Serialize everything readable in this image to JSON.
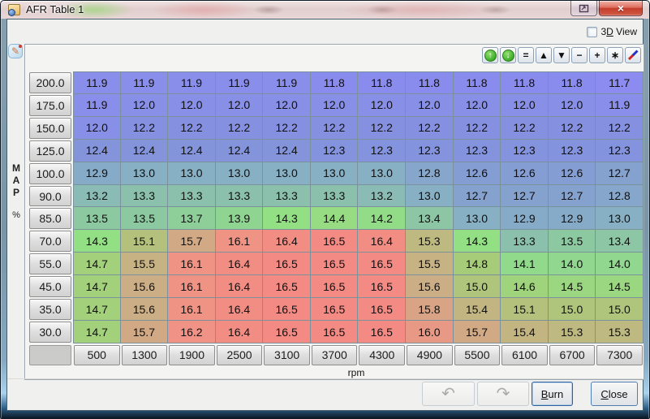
{
  "window": {
    "title": "AFR Table 1",
    "controls": {
      "close_glyph": "×"
    }
  },
  "view_toggle": {
    "label": "3D View",
    "mnemonic_index": 1,
    "checked": false
  },
  "toolbar": {
    "icons": [
      {
        "name": "table-send-up-icon",
        "style": "green-circle",
        "glyph": "↑"
      },
      {
        "name": "table-send-down-icon",
        "style": "green-circle",
        "glyph": "↓"
      },
      {
        "name": "set-equal-icon",
        "style": "plain",
        "glyph": "="
      },
      {
        "name": "increment-icon",
        "style": "plain",
        "glyph": "▲"
      },
      {
        "name": "decrement-icon",
        "style": "plain",
        "glyph": "▼"
      },
      {
        "name": "subtract-icon",
        "style": "plain",
        "glyph": "−"
      },
      {
        "name": "add-icon",
        "style": "plain",
        "glyph": "+"
      },
      {
        "name": "multiply-icon",
        "style": "plain",
        "glyph": "∗"
      },
      {
        "name": "pencil-icon",
        "style": "pencil",
        "glyph": ""
      }
    ]
  },
  "table": {
    "y_axis_letters": [
      "M",
      "A",
      "P"
    ],
    "y_axis_unit": "%",
    "x_axis_label": "rpm",
    "map_bins": [
      "200.0",
      "175.0",
      "150.0",
      "125.0",
      "100.0",
      "90.0",
      "85.0",
      "70.0",
      "55.0",
      "45.0",
      "35.0",
      "30.0"
    ],
    "rpm_bins": [
      "500",
      "1300",
      "1900",
      "2500",
      "3100",
      "3700",
      "4300",
      "4900",
      "5500",
      "6100",
      "6700",
      "7300"
    ],
    "values": [
      [
        "11.9",
        "11.9",
        "11.9",
        "11.9",
        "11.9",
        "11.8",
        "11.8",
        "11.8",
        "11.8",
        "11.8",
        "11.8",
        "11.7"
      ],
      [
        "11.9",
        "12.0",
        "12.0",
        "12.0",
        "12.0",
        "12.0",
        "12.0",
        "12.0",
        "12.0",
        "12.0",
        "12.0",
        "11.9"
      ],
      [
        "12.0",
        "12.2",
        "12.2",
        "12.2",
        "12.2",
        "12.2",
        "12.2",
        "12.2",
        "12.2",
        "12.2",
        "12.2",
        "12.2"
      ],
      [
        "12.4",
        "12.4",
        "12.4",
        "12.4",
        "12.4",
        "12.3",
        "12.3",
        "12.3",
        "12.3",
        "12.3",
        "12.3",
        "12.3"
      ],
      [
        "12.9",
        "13.0",
        "13.0",
        "13.0",
        "13.0",
        "13.0",
        "13.0",
        "12.8",
        "12.6",
        "12.6",
        "12.6",
        "12.7"
      ],
      [
        "13.2",
        "13.3",
        "13.3",
        "13.3",
        "13.3",
        "13.3",
        "13.2",
        "13.0",
        "12.7",
        "12.7",
        "12.7",
        "12.8"
      ],
      [
        "13.5",
        "13.5",
        "13.7",
        "13.9",
        "14.3",
        "14.4",
        "14.2",
        "13.4",
        "13.0",
        "12.9",
        "12.9",
        "13.0"
      ],
      [
        "14.3",
        "15.1",
        "15.7",
        "16.1",
        "16.4",
        "16.5",
        "16.4",
        "15.3",
        "14.3",
        "13.3",
        "13.5",
        "13.4"
      ],
      [
        "14.7",
        "15.5",
        "16.1",
        "16.4",
        "16.5",
        "16.5",
        "16.5",
        "15.5",
        "14.8",
        "14.1",
        "14.0",
        "14.0"
      ],
      [
        "14.7",
        "15.6",
        "16.1",
        "16.4",
        "16.5",
        "16.5",
        "16.5",
        "15.6",
        "15.0",
        "14.6",
        "14.5",
        "14.5"
      ],
      [
        "14.7",
        "15.6",
        "16.1",
        "16.4",
        "16.5",
        "16.5",
        "16.5",
        "15.8",
        "15.4",
        "15.1",
        "15.0",
        "15.0"
      ],
      [
        "14.7",
        "15.7",
        "16.2",
        "16.4",
        "16.5",
        "16.5",
        "16.5",
        "16.0",
        "15.7",
        "15.4",
        "15.3",
        "15.3"
      ]
    ],
    "value_min": 11.7,
    "value_max": 16.5,
    "color_stops": [
      {
        "v": 11.7,
        "c": "#8b8bf0"
      },
      {
        "v": 12.4,
        "c": "#8394da"
      },
      {
        "v": 13.0,
        "c": "#87b0c4"
      },
      {
        "v": 13.4,
        "c": "#8cc6a4"
      },
      {
        "v": 14.3,
        "c": "#93df84"
      },
      {
        "v": 14.8,
        "c": "#a7cc79"
      },
      {
        "v": 15.6,
        "c": "#cbae85"
      },
      {
        "v": 16.1,
        "c": "#ef9485"
      },
      {
        "v": 16.5,
        "c": "#f38a84"
      }
    ]
  },
  "footer": {
    "undo_icon": "↶",
    "redo_icon": "↷",
    "burn": {
      "label": "Burn",
      "mnemonic_index": 0
    },
    "close": {
      "label": "Close",
      "mnemonic_index": 0
    }
  }
}
